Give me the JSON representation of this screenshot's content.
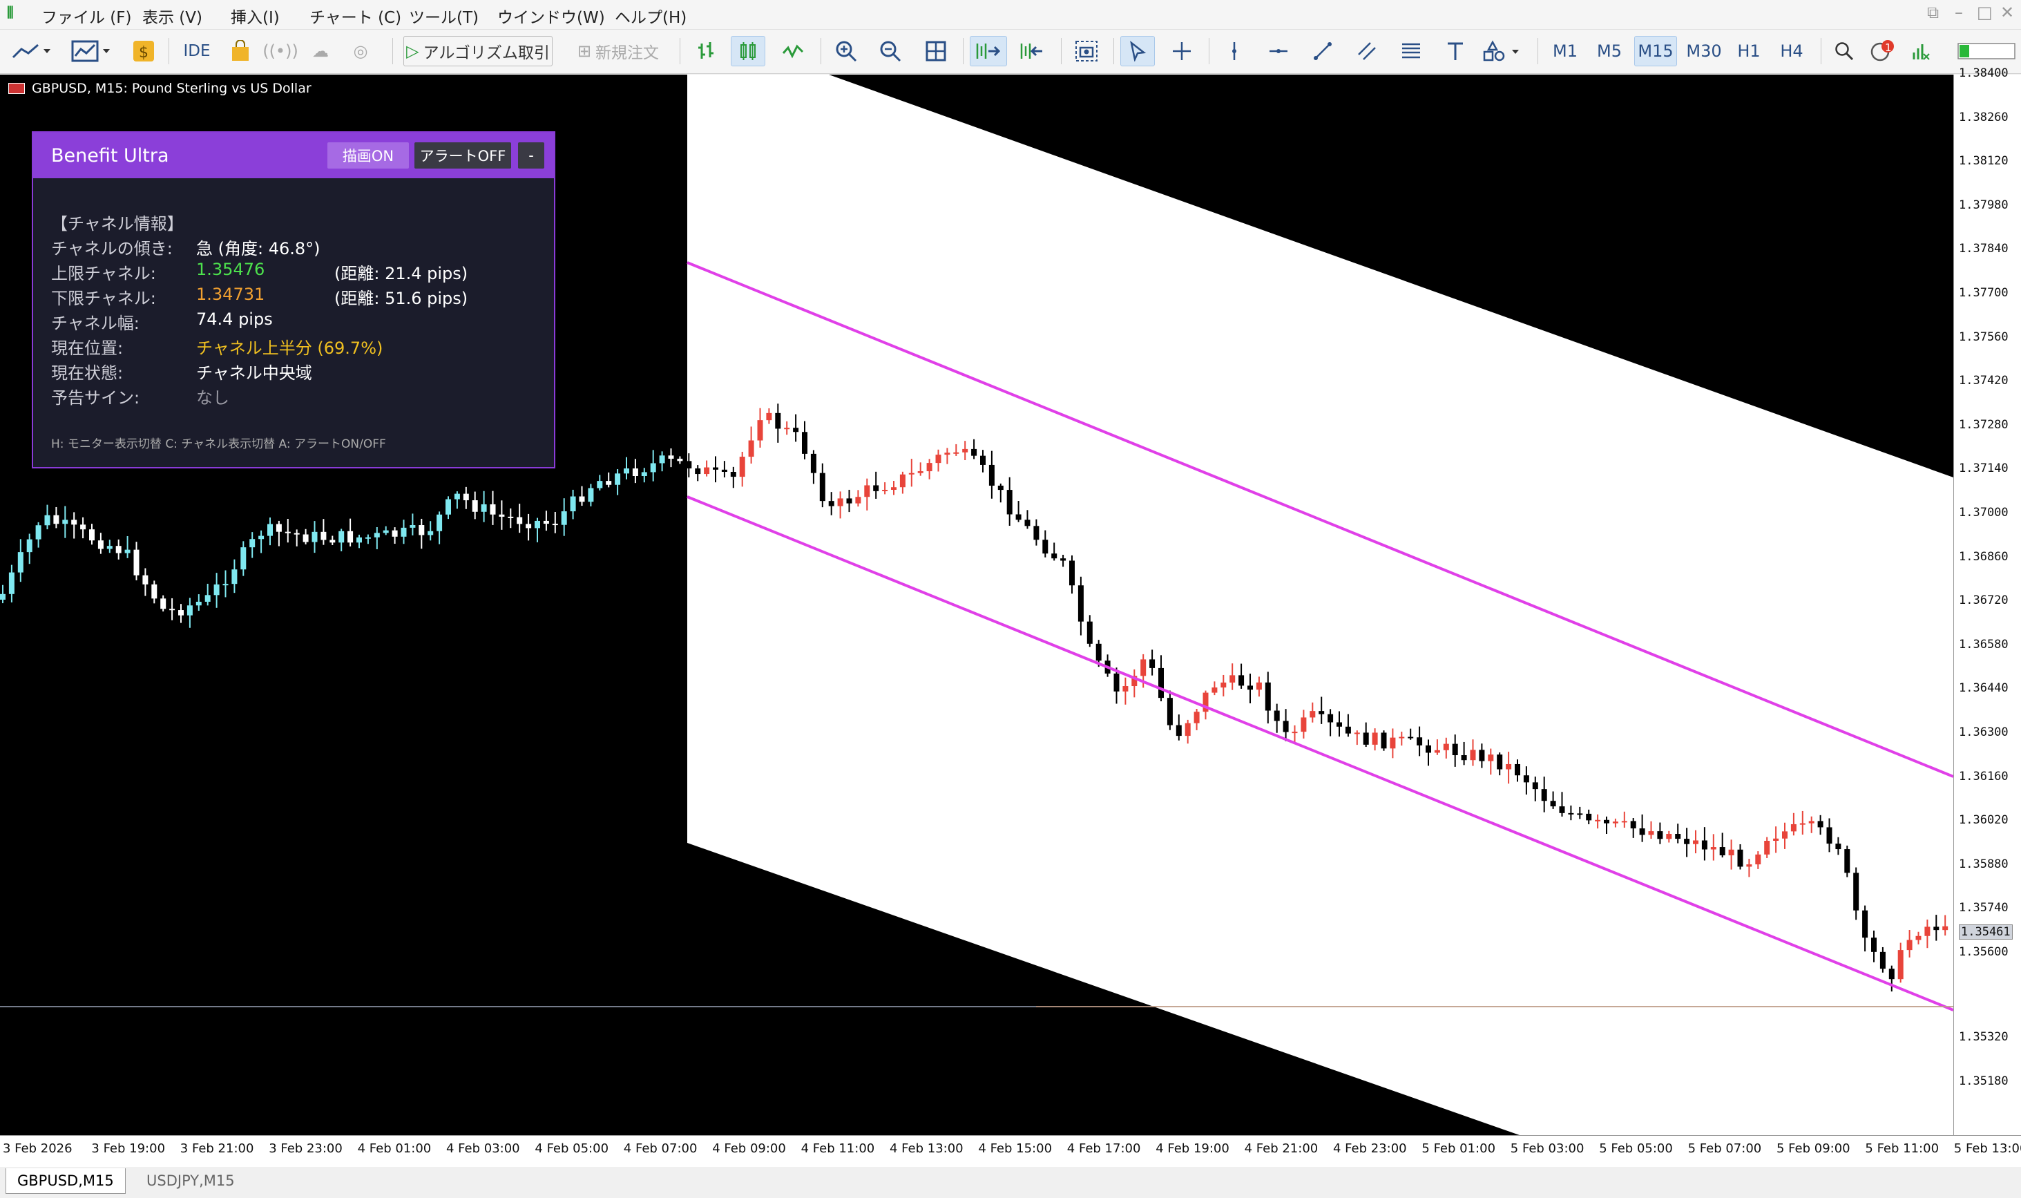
{
  "menu": {
    "items": [
      "ファイル (F)",
      "表示 (V)",
      "挿入(I)",
      "チャート (C)",
      "ツール(T)",
      "ウインドウ(W)",
      "ヘルプ(H)"
    ]
  },
  "toolbar": {
    "ide_label": "IDE",
    "algo_label": "アルゴリズム取引",
    "new_order_label": "新規注文",
    "timeframes": [
      "M1",
      "M5",
      "M15",
      "M30",
      "H1",
      "H4"
    ],
    "active_timeframe": "M15",
    "notification_count": "1"
  },
  "chart": {
    "title": "GBPUSD, M15:  Pound Sterling vs US Dollar",
    "current_price": "1.35461",
    "price_ticks": [
      "1.38400",
      "1.38260",
      "1.38120",
      "1.37980",
      "1.37840",
      "1.37700",
      "1.37560",
      "1.37420",
      "1.37280",
      "1.37140",
      "1.37000",
      "1.36860",
      "1.36720",
      "1.36580",
      "1.36440",
      "1.36300",
      "1.36160",
      "1.36020",
      "1.35880",
      "1.35740",
      "1.35600",
      "1.35461",
      "1.35320",
      "1.35180"
    ],
    "time_ticks": [
      "3 Feb 2026",
      "3 Feb 19:00",
      "3 Feb 21:00",
      "3 Feb 23:00",
      "4 Feb 01:00",
      "4 Feb 03:00",
      "4 Feb 05:00",
      "4 Feb 07:00",
      "4 Feb 09:00",
      "4 Feb 11:00",
      "4 Feb 13:00",
      "4 Feb 15:00",
      "4 Feb 17:00",
      "4 Feb 19:00",
      "4 Feb 21:00",
      "4 Feb 23:00",
      "5 Feb 01:00",
      "5 Feb 03:00",
      "5 Feb 05:00",
      "5 Feb 07:00",
      "5 Feb 09:00",
      "5 Feb 11:00",
      "5 Feb 13:00"
    ],
    "colors": {
      "bull_black_bg": "#7fe8f0",
      "bear_black_bg": "#ffffff",
      "bull_white_bg": "#e8443a",
      "bear_white_bg": "#000000",
      "channel": "#e040e8"
    }
  },
  "panel": {
    "title": "Benefit Ultra",
    "btn_draw": "描画ON",
    "btn_alert": "アラートOFF",
    "btn_min": "-",
    "section": "【チャネル情報】",
    "rows": {
      "slope_label": "チャネルの傾き:",
      "slope_value": "急 (角度: 46.8°)",
      "upper_label": "上限チャネル:",
      "upper_value": "1.35476",
      "upper_dist": "(距離: 21.4 pips)",
      "lower_label": "下限チャネル:",
      "lower_value": "1.34731",
      "lower_dist": "(距離: 51.6 pips)",
      "width_label": "チャネル幅:",
      "width_value": "74.4 pips",
      "position_label": "現在位置:",
      "position_value": "チャネル上半分 (69.7%)",
      "state_label": "現在状態:",
      "state_value": "チャネル中央域",
      "sign_label": "予告サイン:",
      "sign_value": "なし"
    },
    "hint": "H: モニター表示切替  C: チャネル表示切替  A: アラートON/OFF"
  },
  "tabs": [
    "GBPUSD,M15",
    "USDJPY,M15"
  ]
}
